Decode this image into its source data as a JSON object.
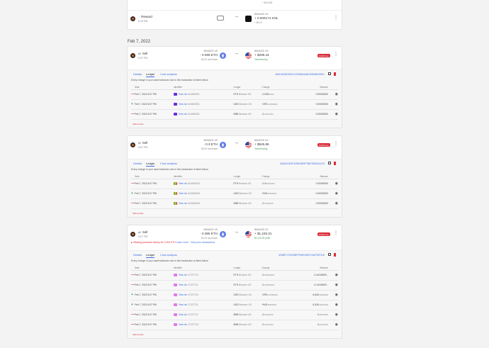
{
  "top_card": {
    "partial_value": "+ $0.0039",
    "reward": {
      "label": "Reward",
      "time": "6:43 PM",
      "to_exchange": "BINANCE US",
      "to_amount": "+ 0.000174 SOL",
      "to_value": "+ $0.02"
    }
  },
  "date_header": "Feb 7, 2022",
  "transactions": [
    {
      "type": "Sell",
      "time": "6:07 PM",
      "from_exchange": "BINANCE US",
      "from_amount": "- 0.095 ETH",
      "cost_basis": "$0.00 cost basis",
      "to_exchange": "BINANCE US",
      "to_amount": "+ $299.44",
      "to_sub": "Gain/missing",
      "fee_badge": "0.00% fee",
      "tabs": [
        "Details",
        "Ledger",
        "Cost analysis"
      ],
      "tx_hash": "#06C362D03E61C4300BA4446192B3B029301",
      "intro": "Every change in your asset balances due to this transaction is listed below.",
      "columns": [
        "Date",
        "Identifier",
        "Ledger",
        "Change",
        "Balance"
      ],
      "rows": [
        {
          "sign": "—",
          "date": "Feb 7, 2022 6:07 PM",
          "link": "View txn",
          "id": "844460531",
          "asset": "ETH",
          "ledger": "Binance US",
          "change": "-0.095",
          "change_small": "00000",
          "balance": "0.00000000"
        },
        {
          "sign": "+",
          "date": "Feb 7, 2022 6:07 PM",
          "link": "View txn",
          "id": "844460531",
          "asset": "USD",
          "ledger": "Binance US",
          "change": "+299.",
          "change_small": "442580000",
          "balance": "0.00000000"
        },
        {
          "sign": "—",
          "date": "Feb 7, 2022 6:07 PM",
          "link": "View txn",
          "id": "844460531",
          "asset": "BNB",
          "ledger": "Binance US",
          "change": "-0.",
          "change_small": "00001532",
          "balance": "0.00000000"
        }
      ],
      "split_label": "Split entries"
    },
    {
      "type": "Sell",
      "time": "6:07 PM",
      "from_exchange": "BINANCE US",
      "from_amount": "- 0.3 ETH",
      "cost_basis": "$0.00 cost basis",
      "to_exchange": "BINANCE US",
      "to_amount": "+ $945.86",
      "to_sub": "Gain/missing",
      "fee_badge": "0.00% fee",
      "tabs": [
        "Details",
        "Ledger",
        "Cost analysis"
      ],
      "tx_hash": "#3A4014D2F4496C8D9F7B670D0A41A7A",
      "intro": "Every change in your asset balances due to this transaction is listed below.",
      "columns": [
        "Date",
        "Identifier",
        "Ledger",
        "Change",
        "Balance"
      ],
      "rows": [
        {
          "sign": "—",
          "date": "Feb 7, 2022 6:07 PM",
          "link": "View txn",
          "id": "844460528",
          "asset": "ETH",
          "ledger": "Binance US",
          "change": "-0.3",
          "change_small": "00000000",
          "balance": "0.00000000"
        },
        {
          "sign": "+",
          "date": "Feb 7, 2022 6:07 PM",
          "link": "View txn",
          "id": "844460528",
          "asset": "USD",
          "ledger": "Binance US",
          "change": "+945.",
          "change_small": "86660000",
          "balance": "0.00000000"
        },
        {
          "sign": "—",
          "date": "Feb 7, 2022 6:07 PM",
          "link": "View txn",
          "id": "844460528",
          "asset": "BNB",
          "ledger": "Binance US",
          "change": "-0.",
          "change_small": "00183155",
          "balance": "0.00000000"
        }
      ],
      "split_label": "Split entries"
    },
    {
      "type": "Sell",
      "time": "6:07 PM",
      "from_exchange": "BINANCE US",
      "from_amount": "- 0.395 ETH",
      "cost_basis": "$1.03 cost basis",
      "to_exchange": "BINANCE US",
      "to_amount": "+ $1,245.31",
      "to_sub": "$1,244.28 profit",
      "fee_badge": "0.00% fee",
      "warning": "Missing purchase history for 0.393 ETH",
      "warning_links": [
        "Learn more",
        "View prior transactions"
      ],
      "tabs": [
        "Details",
        "Ledger",
        "Cost analysis"
      ],
      "tx_hash": "#D69FC7D23DBFFE5ED05CF442F33F31E",
      "intro": "Every change in your asset balances due to this transaction is listed below.",
      "columns": [
        "Date",
        "Identifier",
        "Ledger",
        "Change",
        "Balance"
      ],
      "rows": [
        {
          "sign": "—",
          "date": "Feb 7, 2022 6:07 PM",
          "link": "View txn",
          "id": "27227710",
          "asset": "ETH",
          "ledger": "Binance US",
          "change": "-0.",
          "change_small": "095000000",
          "balance": "-0.44145000",
          "balance_extra": "-"
        },
        {
          "sign": "—",
          "date": "Feb 7, 2022 6:07 PM",
          "link": "View txn",
          "id": "27227711",
          "asset": "ETH",
          "ledger": "Binance US",
          "change": "-0.",
          "change_small": "300000000",
          "balance": "-0.14145000",
          "balance_extra": "-"
        },
        {
          "sign": "+",
          "date": "Feb 7, 2022 6:07 PM",
          "link": "View txn",
          "id": "27227710",
          "asset": "USD",
          "ledger": "Binance US",
          "change": "+299.",
          "change_small": "442580000",
          "balance": "6,645.",
          "balance_small": "59980000"
        },
        {
          "sign": "+",
          "date": "Feb 7, 2022 6:07 PM",
          "link": "View txn",
          "id": "27227711",
          "asset": "USD",
          "ledger": "Binance US",
          "change": "+945.",
          "change_small": "86660000",
          "balance": "6,345.",
          "balance_small": "96400000"
        },
        {
          "sign": "—",
          "date": "Feb 7, 2022 6:07 PM",
          "link": "View txn",
          "id": "27227711",
          "asset": "BNB",
          "ledger": "Binance US",
          "change": "-0.",
          "change_small": "00183155",
          "balance": "0.",
          "balance_small": "08978680"
        },
        {
          "sign": "—",
          "date": "Feb 7, 2022 6:07 PM",
          "link": "View txn",
          "id": "27227710",
          "asset": "BNB",
          "ledger": "Binance US",
          "change": "-0.",
          "change_small": "00001532",
          "balance": "0.",
          "balance_small": "09143029"
        }
      ],
      "split_label": "Split entries"
    }
  ],
  "colors": {
    "link": "#3e6fe0",
    "negative": "#d92d3a",
    "positive": "#36a856",
    "eth": "#627eea"
  },
  "icons": [
    "eth-coin-icon",
    "usd-flag-icon",
    "sol-coin-icon",
    "arrow-right-icon",
    "kebab-menu-icon",
    "eye-icon",
    "edit-icon",
    "trash-icon"
  ]
}
